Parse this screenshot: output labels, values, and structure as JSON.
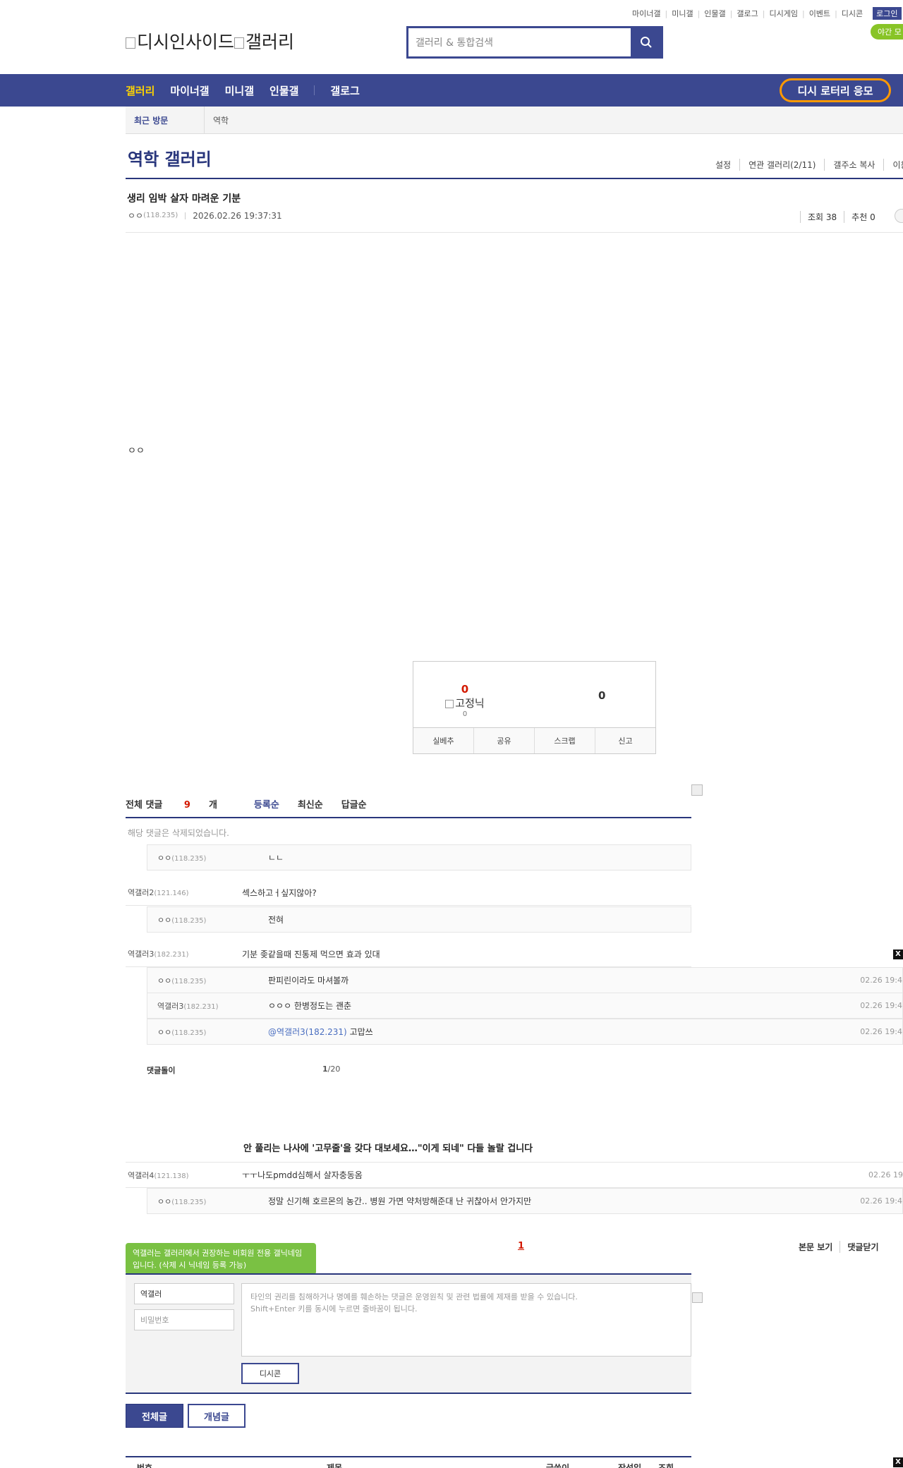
{
  "top_links": [
    "마이너갤",
    "미니갤",
    "인물갤",
    "갤로그",
    "디시게임",
    "이벤트",
    "디시콘"
  ],
  "login_label": "로그인",
  "night_mode_label": "야간 모",
  "logo_text": "디시인사이드",
  "logo_gallery_text": "갤러리",
  "search": {
    "placeholder": "갤러리 & 통합검색"
  },
  "nav": {
    "items": [
      "갤러리",
      "마이너갤",
      "미니갤",
      "인물갤",
      "갤로그"
    ],
    "lotto": "디시 로터리 응모"
  },
  "recent": {
    "label": "최근 방문",
    "item": "역학"
  },
  "gallery": {
    "title": "역학 갤러리",
    "links": [
      "설정",
      "연관 갤러리(2/11)",
      "갤주소 복사",
      "이용"
    ]
  },
  "post": {
    "title": "생리 임박 살자 마려운 기분",
    "author": "ㅇㅇ",
    "ip": "(118.235)",
    "date": "2026.02.26 19:37:31",
    "views": "조회 38",
    "recommend": "추천 0",
    "body": "ㅇㅇ"
  },
  "recommend_box": {
    "up_count": "0",
    "fixed_label": "고정닉",
    "fixed_count": "0",
    "down_count": "0",
    "buttons": [
      "실베추",
      "공유",
      "스크랩",
      "신고"
    ]
  },
  "comments": {
    "tabs": {
      "all_prefix": "전체 댓글 ",
      "count": "9",
      "unit": "개",
      "order_reg": "등록순",
      "order_new": "최신순",
      "order_reply": "답글순"
    },
    "deleted_text": "해당 댓글은 삭제되었습니다.",
    "rows": [
      {
        "type": "reply",
        "nick": "ㅇㅇ",
        "ip": "(118.235)",
        "text": "ㄴㄴ",
        "date": ""
      },
      {
        "type": "comment",
        "nick": "역갤러2",
        "ip": "(121.146)",
        "text": "섹스하고ㅓ싶지않아?",
        "date": ""
      },
      {
        "type": "reply",
        "nick": "ㅇㅇ",
        "ip": "(118.235)",
        "text": "전혀",
        "date": ""
      },
      {
        "type": "comment",
        "nick": "역갤러3",
        "ip": "(182.231)",
        "text": "기분 좆같을때 진통제 먹으면 효과 있대",
        "date": ""
      },
      {
        "type": "reply",
        "nick": "ㅇㅇ",
        "ip": "(118.235)",
        "text": "판피린이라도 마셔볼까",
        "date": "02.26 19:4"
      },
      {
        "type": "reply",
        "nick": "역갤러3",
        "ip": "(182.231)",
        "text": "ㅇㅇㅇ 한병정도는 괜춘",
        "date": "02.26 19:4"
      },
      {
        "type": "reply",
        "nick": "ㅇㅇ",
        "ip": "(118.235)",
        "mention": "@역갤러3(182.231)",
        "text": " 고맙쓰",
        "date": "02.26 19:4"
      },
      {
        "type": "comment",
        "nick": "역갤러4",
        "ip": "(121.138)",
        "text": "ㅜㅜ나도pmdd심해서 살자충동옴",
        "date": "02.26 19"
      },
      {
        "type": "reply",
        "nick": "ㅇㅇ",
        "ip": "(118.235)",
        "text": "정말 신기해 호르몬의 농간.. 병원 가면 약처방해준대 난 귀찮아서 안가지만",
        "date": "02.26 19:4"
      }
    ],
    "dolgi_label": "댓글돌이",
    "dolgi_page": "1",
    "dolgi_total": "/20",
    "ad_title": "안 풀리는 나사에 '고무줄'을 갖다 대보세요…\"이게 되네\" 다들 놀랄 겁니다",
    "page": "1",
    "actions": [
      "본문 보기",
      "댓글닫기"
    ]
  },
  "write": {
    "tooltip": "역갤러는 갤러리에서 권장하는 비회원 전용 갤닉네임입니다. (삭제 시 닉네임 등록 가능)",
    "nick_value": "역갤러",
    "password_placeholder": "비밀번호",
    "textarea_placeholder_1": "타인의 권리를 침해하거나 명예를 훼손하는 댓글은 운영원칙 및 관련 법률에 제재를 받을 수 있습니다.",
    "textarea_placeholder_2": "Shift+Enter 키를 동시에 누르면 줄바꿈이 됩니다.",
    "dccon": "디시콘"
  },
  "list_buttons": {
    "all": "전체글",
    "concept": "개념글"
  },
  "list_head": [
    "번호",
    "제목",
    "글쓴이",
    "작성일",
    "조회"
  ],
  "close_label": "X",
  "colors": {
    "primary": "#3b4890",
    "accent": "#d31900",
    "nav_active": "#ffd400",
    "lotto_border": "#ff9900",
    "tooltip": "#7ac143"
  }
}
